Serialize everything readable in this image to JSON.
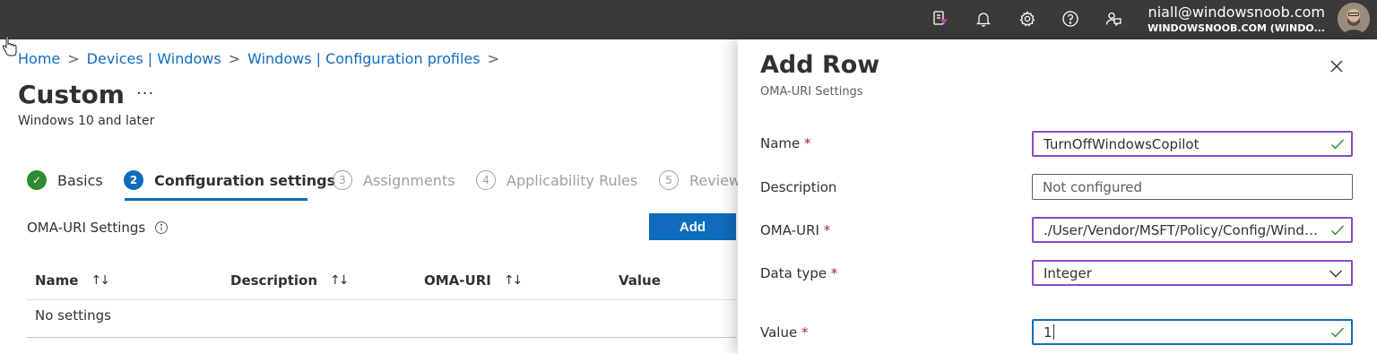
{
  "topbar": {
    "user_email": "niall@windowsnoob.com",
    "user_tenant": "WINDOWSNOOB.COM (WINDO...",
    "icons": [
      "feedback-filter-icon",
      "bell-icon",
      "gear-icon",
      "help-icon",
      "feedback-icon"
    ]
  },
  "breadcrumb": {
    "items": [
      "Home",
      "Devices | Windows",
      "Windows | Configuration profiles"
    ],
    "separator": ">"
  },
  "page": {
    "title": "Custom",
    "more": "···",
    "subtitle": "Windows 10 and later"
  },
  "steps": [
    {
      "number": "✓",
      "label": "Basics",
      "state": "done"
    },
    {
      "number": "2",
      "label": "Configuration settings",
      "state": "active"
    },
    {
      "number": "3",
      "label": "Assignments",
      "state": "todo"
    },
    {
      "number": "4",
      "label": "Applicability Rules",
      "state": "todo"
    },
    {
      "number": "5",
      "label": "Review",
      "state": "todo"
    }
  ],
  "oma_section": {
    "label": "OMA-URI Settings",
    "add_label": "Add"
  },
  "table": {
    "columns": [
      "Name",
      "Description",
      "OMA-URI",
      "Value"
    ],
    "sort_glyph": "↑↓",
    "empty_text": "No settings"
  },
  "panel": {
    "title": "Add Row",
    "subtitle": "OMA-URI Settings",
    "required_mark": "*",
    "fields": {
      "name": {
        "label": "Name",
        "value": "TurnOffWindowsCopilot"
      },
      "description": {
        "label": "Description",
        "placeholder": "Not configured"
      },
      "oma_uri": {
        "label": "OMA-URI",
        "value": "./User/Vendor/MSFT/Policy/Config/WindowsAI/TurnOffWindowsCopilot"
      },
      "data_type": {
        "label": "Data type",
        "value": "Integer"
      },
      "value": {
        "label": "Value",
        "value": "1"
      }
    }
  },
  "colors": {
    "topbar": "#3b3a39",
    "accent": "#0f6cbd",
    "valid_border": "#8a4ac5",
    "success": "#2e8b2e",
    "required": "#a4262c"
  }
}
